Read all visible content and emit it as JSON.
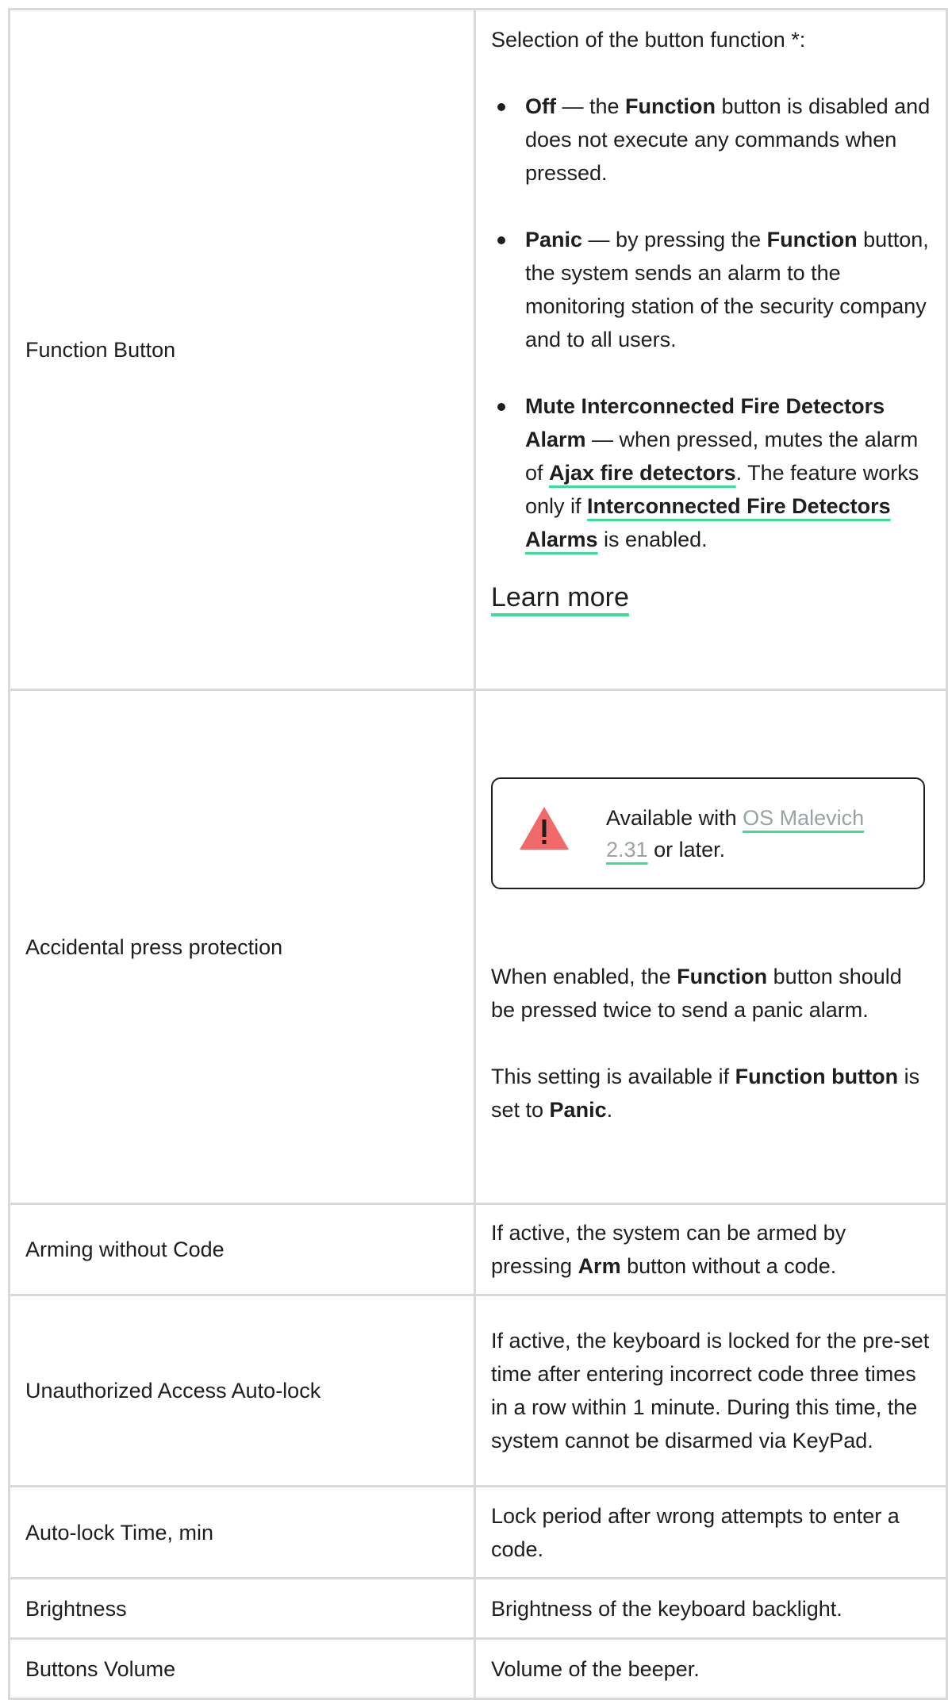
{
  "rows": [
    {
      "setting": "Function Button",
      "intro": "Selection of the button function *:",
      "options": [
        {
          "name": "Off",
          "text": " — the ",
          "strong": "Function",
          "rest": " button is disabled and does not execute any commands when pressed."
        },
        {
          "name": "Panic",
          "text": " — by pressing the ",
          "strong": "Function",
          "rest": " button, the system sends an alarm to the monitoring station of the security company and to all users."
        },
        {
          "name": "Mute Interconnected Fire Detectors Alarm",
          "text": " — when pressed, mutes the alarm of ",
          "link1": "Ajax fire detectors",
          "mid": ". The feature works only if ",
          "link2": "Interconnected Fire Detectors Alarms",
          "rest": " is enabled."
        }
      ],
      "learn_more": "Learn more"
    },
    {
      "setting": "Accidental press protection",
      "note_prefix": "Available with ",
      "note_link": "OS Malevich 2.31",
      "note_suffix": " or later.",
      "p1_a": "When enabled, the ",
      "p1_b": "Function",
      "p1_c": " button should be pressed twice to send a panic alarm.",
      "p2_a": "This setting is available if ",
      "p2_b": "Function button",
      "p2_c": " is set to ",
      "p2_d": "Panic",
      "p2_e": "."
    },
    {
      "setting": "Arming without Code",
      "a": "If active, the system can be armed by pressing ",
      "b": "Arm",
      "c": " button without a code."
    },
    {
      "setting": "Unauthorized Access Auto-lock",
      "desc": "If active, the keyboard is locked for the pre-set time after entering incorrect code three times in a row within 1 minute. During this time, the system cannot be disarmed via KeyPad."
    },
    {
      "setting": "Auto-lock Time, min",
      "desc": "Lock period after wrong attempts to enter a code."
    },
    {
      "setting": "Brightness",
      "desc": "Brightness of the keyboard backlight."
    },
    {
      "setting": "Buttons Volume",
      "desc": "Volume of the beeper."
    }
  ],
  "colors": {
    "accent_underline": "#3ddc97",
    "warning": "#f06a6a",
    "border": "#d9d9d9"
  },
  "icons": {
    "warning": "warning-triangle-icon"
  }
}
